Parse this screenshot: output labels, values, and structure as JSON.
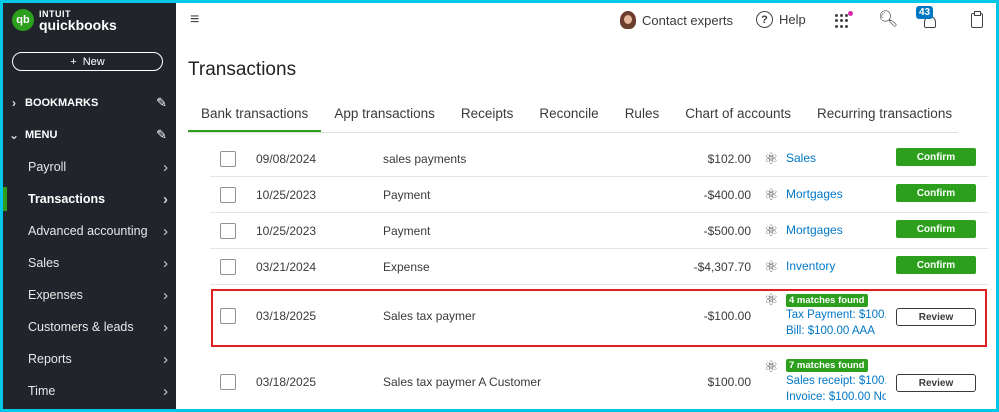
{
  "brand": {
    "intuit": "INTUIT",
    "product": "quickbooks",
    "mark": "qb"
  },
  "sidebar": {
    "new_label": "New",
    "bookmarks_label": "BOOKMARKS",
    "menu_label": "MENU",
    "items": [
      {
        "label": "Payroll"
      },
      {
        "label": "Transactions"
      },
      {
        "label": "Advanced accounting"
      },
      {
        "label": "Sales"
      },
      {
        "label": "Expenses"
      },
      {
        "label": "Customers & leads"
      },
      {
        "label": "Reports"
      },
      {
        "label": "Time"
      }
    ]
  },
  "topbar": {
    "contact_label": "Contact experts",
    "help_label": "Help",
    "notifications_count": "43"
  },
  "page": {
    "title": "Transactions",
    "tabs": [
      {
        "label": "Bank transactions"
      },
      {
        "label": "App transactions"
      },
      {
        "label": "Receipts"
      },
      {
        "label": "Reconcile"
      },
      {
        "label": "Rules"
      },
      {
        "label": "Chart of accounts"
      },
      {
        "label": "Recurring transactions"
      }
    ]
  },
  "transactions": [
    {
      "date": "09/08/2024",
      "description": "sales payments",
      "amount": "$102.00",
      "category": "Sales",
      "action": "Confirm"
    },
    {
      "date": "10/25/2023",
      "description": "Payment",
      "amount": "-$400.00",
      "category": "Mortgages",
      "action": "Confirm"
    },
    {
      "date": "10/25/2023",
      "description": "Payment",
      "amount": "-$500.00",
      "category": "Mortgages",
      "action": "Confirm"
    },
    {
      "date": "03/21/2024",
      "description": "Expense",
      "amount": "-$4,307.70",
      "category": "Inventory",
      "action": "Confirm"
    },
    {
      "date": "03/18/2025",
      "description": "Sales tax paymer",
      "amount": "-$100.00",
      "matches": "4 matches found",
      "match_line1": "Tax Payment: $100.",
      "match_line2": "Bill: $100.00 AAA",
      "action": "Review"
    },
    {
      "date": "03/18/2025",
      "description": "Sales tax paymer   A Customer",
      "amount": "$100.00",
      "matches": "7 matches found",
      "match_line1": "Sales receipt: $100.",
      "match_line2": "Invoice: $100.00 No",
      "action": "Review"
    }
  ],
  "colors": {
    "brand_green": "#2ca01c",
    "sidebar_bg": "#21252b",
    "link_blue": "#0077c5",
    "highlight_red": "#e02020"
  }
}
